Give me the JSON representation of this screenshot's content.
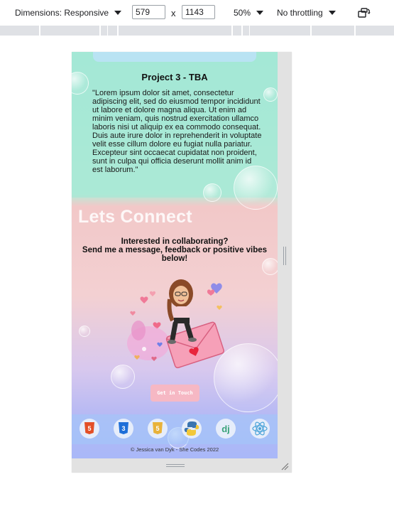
{
  "toolbar": {
    "dimensions_label": "Dimensions: Responsive",
    "width_value": "579",
    "times_symbol": "x",
    "height_value": "1143",
    "zoom_label": "50%",
    "throttle_label": "No throttling",
    "rotate_icon": "rotate-device-icon"
  },
  "page": {
    "project_title": "Project 3 - TBA",
    "project_body": "\"Lorem ipsum dolor sit amet, consectetur adipiscing elit, sed do eiusmod tempor incididunt ut labore et dolore magna aliqua. Ut enim ad minim veniam, quis nostrud exercitation ullamco laboris nisi ut aliquip ex ea commodo consequat. Duis aute irure dolor in reprehenderit in voluptate velit esse cillum dolore eu fugiat nulla pariatur. Excepteur sint occaecat cupidatat non proident, sunt in culpa qui officia deserunt mollit anim id est laborum.\"",
    "connect_heading": "Lets Connect",
    "connect_line1": "Interested in collaborating?",
    "connect_line2": "Send me a message, feedback or positive vibes below!",
    "cta_label": "Get in Touch",
    "tech_icons": [
      "html5-icon",
      "css3-icon",
      "javascript-icon",
      "python-icon",
      "django-icon",
      "react-icon"
    ],
    "footer_text": "© Jessica van Dyk - She Codes 2022"
  },
  "colors": {
    "section_top": "#a8e8d8",
    "section_mid": "#f2c8c8",
    "section_bottom": "#a9b8f8",
    "cta": "#f6b8c4"
  }
}
